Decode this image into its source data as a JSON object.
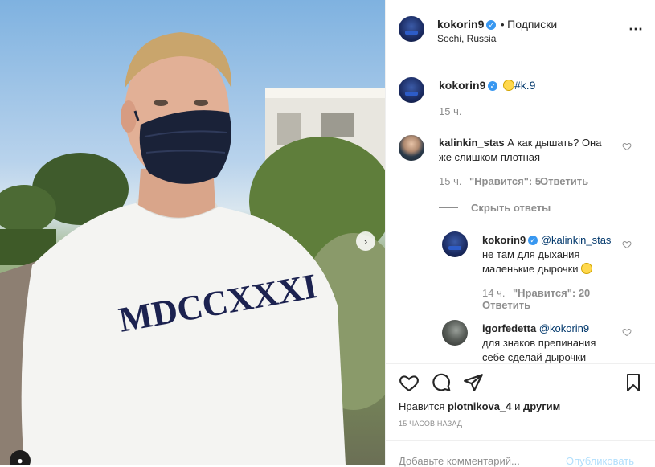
{
  "post": {
    "author": "kokorin9",
    "follow_separator": "•",
    "follow_label": "Подписки",
    "location": "Sochi, Russia",
    "more_icon": "more-horizontal-icon"
  },
  "caption": {
    "author": "kokorin9",
    "hashtag": "#k.9",
    "time": "15 ч."
  },
  "comments": [
    {
      "author": "kalinkin_stas",
      "text_line1": "А как дышать? Она",
      "text_line2": "же слишком плотная",
      "time": "15 ч.",
      "likes": "\"Нравится\": 5",
      "reply": "Ответить",
      "hide_replies": "Скрыть ответы"
    }
  ],
  "replies": [
    {
      "author": "kokorin9",
      "mention": "@kalinkin_stas",
      "text_line1": "не там для дыхания",
      "text_line2": "маленькие дырочки",
      "time": "14 ч.",
      "likes": "\"Нравится\": 20",
      "reply": "Ответить"
    },
    {
      "author": "igorfedetta",
      "mention": "@kokorin9",
      "text_line1": "для знаков препинания",
      "text_line2": "себе сделай дырочки"
    }
  ],
  "likes": {
    "prefix": "Нравится",
    "user": "plotnikova_4",
    "connector": "и",
    "suffix": "другим"
  },
  "timestamp": "15 ЧАСОВ НАЗАД",
  "add_comment": {
    "placeholder": "Добавьте комментарий...",
    "publish": "Опубликовать"
  },
  "photo": {
    "shirt_text": "MDCCXXXI"
  },
  "colors": {
    "link": "#3897f0",
    "verified": "#3897f0",
    "publish_disabled": "#b2dffc"
  }
}
